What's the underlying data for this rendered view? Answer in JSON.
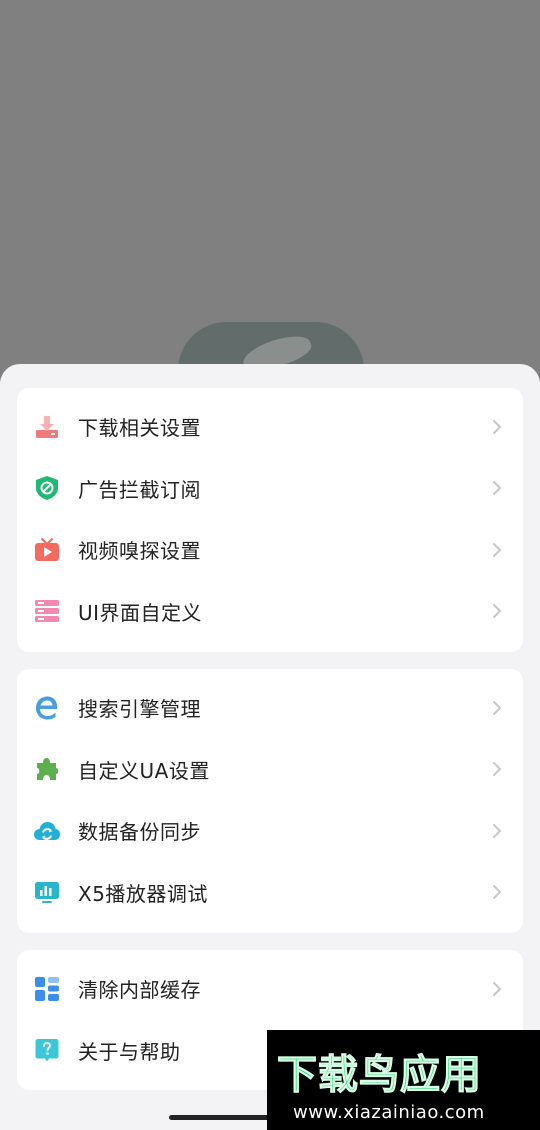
{
  "colors": {
    "overlay": "#808080",
    "sheet_bg": "#f3f3f5",
    "card_bg": "#ffffff",
    "chevron": "#c8c8c8",
    "watermark_green": "#3ed07b"
  },
  "groups": [
    {
      "items": [
        {
          "label": "下载相关设置",
          "icon": "download-icon",
          "icon_color": "#f07a7a"
        },
        {
          "label": "广告拦截订阅",
          "icon": "ad-block-shield-icon",
          "icon_color": "#1fb972"
        },
        {
          "label": "视频嗅探设置",
          "icon": "tv-play-icon",
          "icon_color": "#f46a5e"
        },
        {
          "label": "UI界面自定义",
          "icon": "ui-layout-icon",
          "icon_color": "#f08ab0"
        }
      ]
    },
    {
      "items": [
        {
          "label": "搜索引擎管理",
          "icon": "edge-browser-icon",
          "icon_color": "#4a9ee0"
        },
        {
          "label": "自定义UA设置",
          "icon": "puzzle-icon",
          "icon_color": "#5bb04d"
        },
        {
          "label": "数据备份同步",
          "icon": "cloud-sync-icon",
          "icon_color": "#22b0d8"
        },
        {
          "label": "X5播放器调试",
          "icon": "chart-monitor-icon",
          "icon_color": "#2ab5c8"
        }
      ]
    },
    {
      "items": [
        {
          "label": "清除内部缓存",
          "icon": "grid-blocks-icon",
          "icon_color": "#3d8ee6"
        },
        {
          "label": "关于与帮助",
          "icon": "help-icon",
          "icon_color": "#3cc7d8"
        }
      ]
    }
  ],
  "watermark": {
    "title": "下载鸟应用",
    "url": "www.xiazainiao.com"
  }
}
